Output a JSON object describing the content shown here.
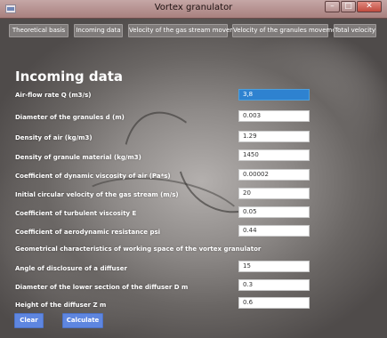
{
  "window": {
    "title": "Vortex granulator"
  },
  "tabs": [
    {
      "label": "Theoretical basis"
    },
    {
      "label": "Incoming data"
    },
    {
      "label": "Velocity of the gas stream movement"
    },
    {
      "label": "Velocity of the granules movement"
    },
    {
      "label": "Total velocity"
    }
  ],
  "heading": "Incoming data",
  "fields": [
    {
      "label": "Air-flow rate Q (m3/s)",
      "value": "3,8"
    },
    {
      "label": "Diameter of the granules d (m)",
      "value": "0.003"
    },
    {
      "label": "Density of air (kg/m3)",
      "value": "1.29"
    },
    {
      "label": "Density of granule material (kg/m3)",
      "value": "1450"
    },
    {
      "label": "Coefficient of dynamic viscosity of air (Pa*s)",
      "value": "0.00002"
    },
    {
      "label": "Initial circular velocity of the gas stream (m/s)",
      "value": "20"
    },
    {
      "label": "Coefficient of turbulent viscosity E",
      "value": "0.05"
    },
    {
      "label": "Coefficient of aerodynamic resistance psi",
      "value": "0.44"
    },
    {
      "label": "Angle of disclosure of a diffuser",
      "value": "15"
    },
    {
      "label": "Diameter of the lower section of the diffuser D m",
      "value": "0.3"
    },
    {
      "label": "Height of the diffuser Z m",
      "value": "0.6"
    }
  ],
  "section_label": "Geometrical characteristics of working space of the vortex granulator",
  "buttons": {
    "clear": "Clear",
    "calculate": "Calculate"
  },
  "colors": {
    "button": "#5e86e0",
    "active_field": "#2e82d0"
  }
}
